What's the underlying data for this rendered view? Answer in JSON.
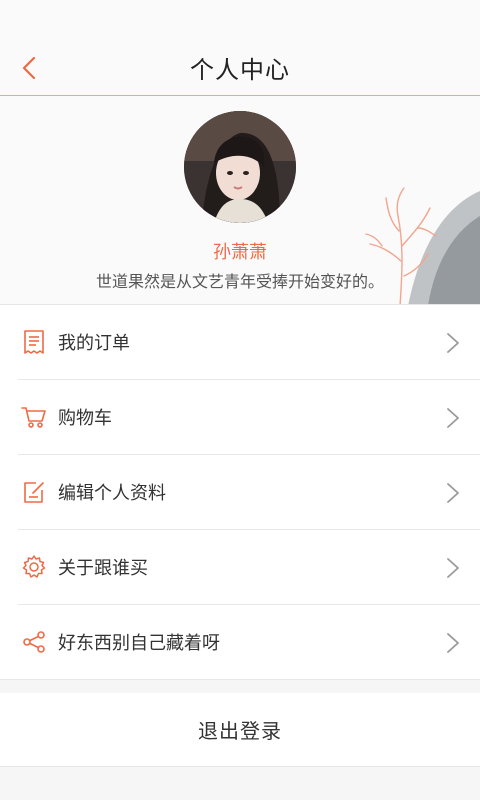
{
  "header": {
    "title": "个人中心"
  },
  "profile": {
    "name": "孙萧萧",
    "bio": "世道果然是从文艺青年受捧开始变好的。"
  },
  "menu": {
    "items": [
      {
        "label": "我的订单",
        "icon": "receipt-icon"
      },
      {
        "label": "购物车",
        "icon": "cart-icon"
      },
      {
        "label": "编辑个人资料",
        "icon": "edit-icon"
      },
      {
        "label": "关于跟谁买",
        "icon": "gear-icon"
      },
      {
        "label": "好东西别自己藏着呀",
        "icon": "share-icon"
      }
    ]
  },
  "logout": {
    "label": "退出登录"
  },
  "colors": {
    "accent": "#ef6a44",
    "divider": "#e8e8e8",
    "background": "#f6f6f6"
  }
}
